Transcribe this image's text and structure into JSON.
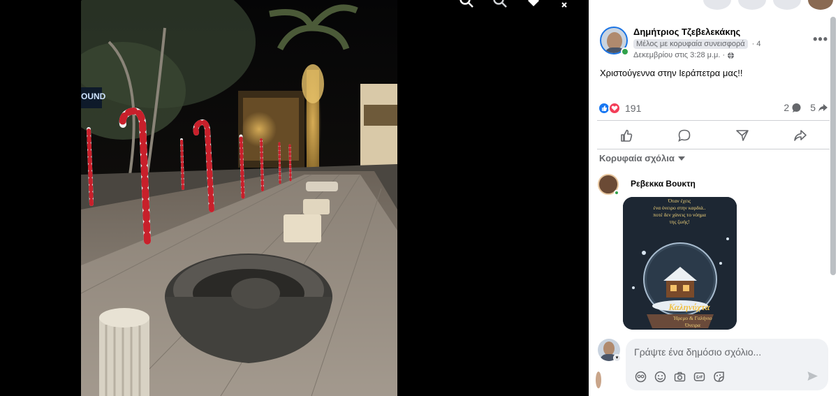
{
  "post": {
    "author": "Δημήτριος Τζεβελεκάκης",
    "badge": "Μέλος με κορυφαία συνεισφορά",
    "badge_suffix": "· 4",
    "date": "Δεκεμβρίου στις 3:28 μ.μ. ·",
    "text": "Χριστούγεννα στην Ιεράπετρα μας!!",
    "reaction_count": "191",
    "comment_count": "2",
    "share_count": "5",
    "more_label": "•••"
  },
  "comments": {
    "section_label": "Κορυφαία σχόλια",
    "items": [
      {
        "name": "Ρεβεκκα Βουκτη",
        "sticker_lines": [
          "Όταν έχεις",
          "ένα όνειρο στην καρδιά..",
          "ποτέ δεν χάνεις το νόημα",
          "της ζωής!"
        ],
        "sticker_big": "Καληνύχτα",
        "sticker_bottom": [
          "Ήρεμο & Γαλήνιο",
          "Όνειρα"
        ]
      }
    ]
  },
  "composer": {
    "placeholder": "Γράψτε ένα δημόσιο σχόλιο..."
  },
  "photo": {
    "sign_text": "OUND"
  },
  "icons": {
    "top_bar": [
      "zoom-in-icon",
      "zoom-out-icon",
      "tag-icon",
      "fullscreen-icon"
    ],
    "actions": [
      "like-icon",
      "comment-icon",
      "send-icon",
      "share-icon"
    ],
    "composer_tools": [
      "avatar-sticker-icon",
      "emoji-icon",
      "camera-icon",
      "gif-icon",
      "sticker-icon"
    ]
  },
  "colors": {
    "accent": "#1877f2",
    "love": "#f33e58",
    "online": "#31a24c",
    "secondary_text": "#65676b"
  }
}
